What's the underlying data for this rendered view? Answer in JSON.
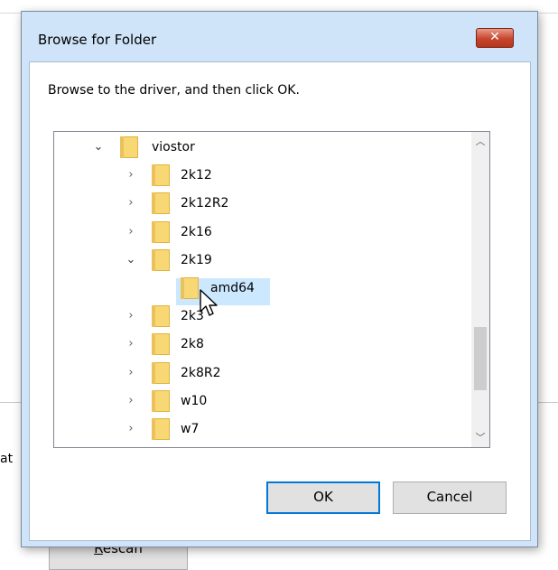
{
  "background": {
    "partial_text": "at",
    "rescan_button": {
      "label_underlined": "R",
      "label_rest": "escan"
    }
  },
  "dialog": {
    "title": "Browse for Folder",
    "close_glyph": "✕",
    "instruction": "Browse to the driver, and then click OK.",
    "tree": {
      "items": [
        {
          "label": "viostor",
          "expander": "expanded",
          "level": 0
        },
        {
          "label": "2k12",
          "expander": "collapsed",
          "level": 1
        },
        {
          "label": "2k12R2",
          "expander": "collapsed",
          "level": 1
        },
        {
          "label": "2k16",
          "expander": "collapsed",
          "level": 1
        },
        {
          "label": "2k19",
          "expander": "expanded",
          "level": 1
        },
        {
          "label": "amd64",
          "expander": "none",
          "level": 2,
          "selected": true
        },
        {
          "label": "2k3",
          "expander": "collapsed",
          "level": 1
        },
        {
          "label": "2k8",
          "expander": "collapsed",
          "level": 1
        },
        {
          "label": "2k8R2",
          "expander": "collapsed",
          "level": 1
        },
        {
          "label": "w10",
          "expander": "collapsed",
          "level": 1
        },
        {
          "label": "w7",
          "expander": "collapsed",
          "level": 1
        }
      ],
      "chevron_expanded": "⌄",
      "chevron_collapsed": "›",
      "icon": "folder-icon"
    },
    "scrollbar": {
      "up_glyph": "︿",
      "down_glyph": "﹀"
    },
    "buttons": {
      "ok": "OK",
      "cancel": "Cancel"
    }
  },
  "colors": {
    "title_frame": "#cfe4f9",
    "selection": "#cce8ff",
    "focus_border": "#0078d7",
    "close_button": "#c7452d",
    "folder": "#f8d775"
  }
}
